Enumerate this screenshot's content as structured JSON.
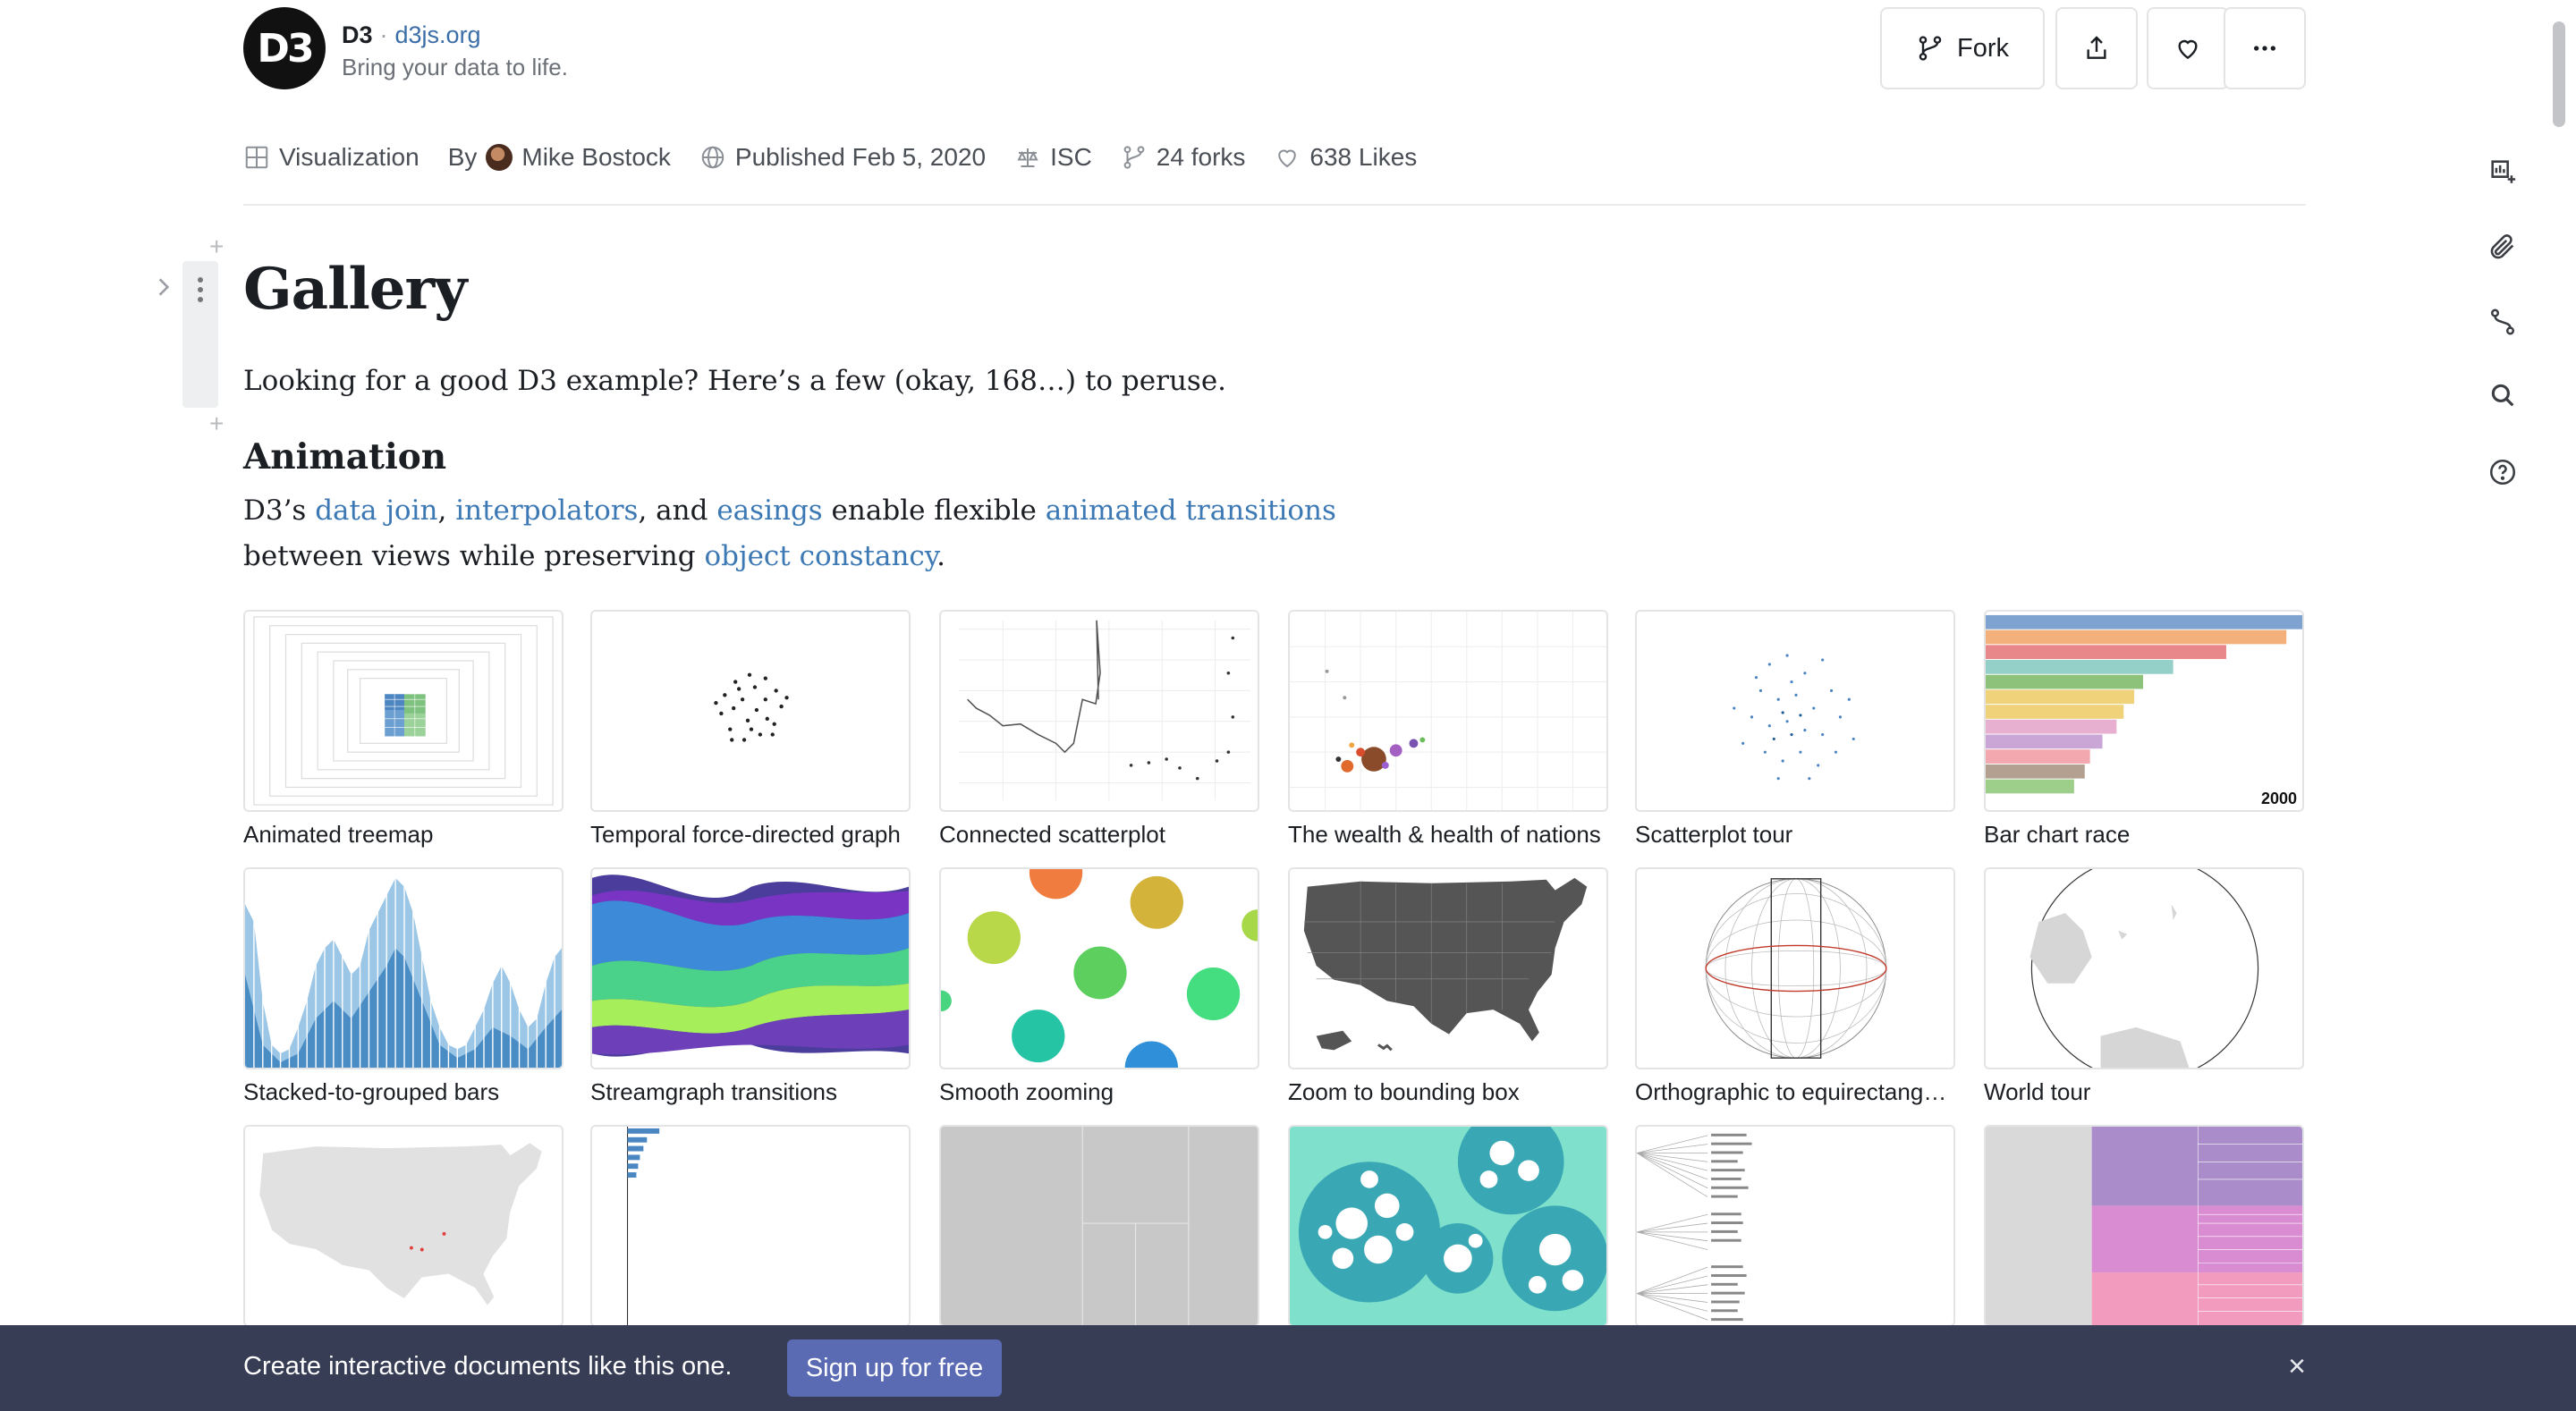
{
  "header": {
    "logo_text": "D3",
    "site_name": "D3",
    "separator": "·",
    "site_url": "d3js.org",
    "tagline": "Bring your data to life.",
    "fork_label": "Fork",
    "fork_icon": "fork-icon",
    "share_icon": "share-icon",
    "like_icon": "heart-icon",
    "more_icon": "more-icon"
  },
  "meta": {
    "type_label": "Visualization",
    "by_label": "By",
    "author": "Mike Bostock",
    "published": "Published Feb 5, 2020",
    "license": "ISC",
    "forks": "24 forks",
    "likes": "638 Likes"
  },
  "rail": [
    "add-cell-icon",
    "paperclip-icon",
    "branch-icon",
    "search-icon",
    "help-icon"
  ],
  "page": {
    "title": "Gallery",
    "intro": "Looking for a good D3 example? Here’s a few (okay, 168…) to peruse.",
    "section_title": "Animation",
    "para": {
      "t1": "D3’s ",
      "link_data_join": "data join",
      "t2": ", ",
      "link_interpolators": "interpolators",
      "t3": ", and ",
      "link_easings": "easings",
      "t4": " enable flexible ",
      "link_animated_transitions": "animated transitions",
      "t5": "between views while preserving ",
      "link_object_constancy": "object constancy",
      "t6": "."
    }
  },
  "gallery": [
    {
      "caption": "Animated treemap"
    },
    {
      "caption": "Temporal force-directed graph"
    },
    {
      "caption": "Connected scatterplot"
    },
    {
      "caption": "The wealth & health of nations"
    },
    {
      "caption": "Scatterplot tour"
    },
    {
      "caption": "Bar chart race",
      "year_label": "2000"
    },
    {
      "caption": "Stacked-to-grouped bars"
    },
    {
      "caption": "Streamgraph transitions"
    },
    {
      "caption": "Smooth zooming"
    },
    {
      "caption": "Zoom to bounding box"
    },
    {
      "caption": "Orthographic to equirectangular"
    },
    {
      "caption": "World tour"
    },
    {
      "caption": ""
    },
    {
      "caption": ""
    },
    {
      "caption": ""
    },
    {
      "caption": ""
    },
    {
      "caption": ""
    },
    {
      "caption": ""
    }
  ],
  "banner": {
    "text": "Create interactive documents like this one.",
    "button": "Sign up for free",
    "close": "×"
  },
  "colors": {
    "link": "#3b78b4",
    "banner_bg": "#373d54",
    "banner_button": "#5a6ab3"
  }
}
